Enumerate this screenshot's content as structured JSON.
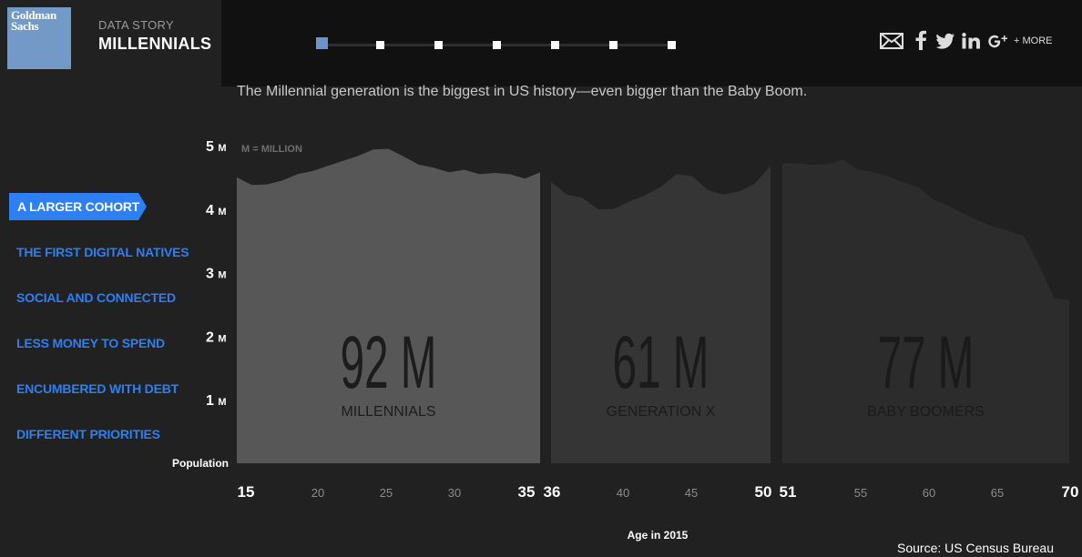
{
  "brand": {
    "logo_text": "Goldman Sachs",
    "logo_color": "#7399c6"
  },
  "header": {
    "kicker": "DATA STORY",
    "title": "MILLENNIALS"
  },
  "progress": {
    "steps": 7,
    "current": 1,
    "active_color": "#6d94c6"
  },
  "share": {
    "icons": [
      "mail-icon",
      "facebook-icon",
      "twitter-icon",
      "linkedin-icon",
      "google-plus-icon"
    ],
    "more_label": "+ MORE"
  },
  "intro_text": "The Millennial generation is the biggest in US history—even bigger than the Baby Boom.",
  "nav": {
    "items": [
      {
        "label": "A LARGER COHORT"
      },
      {
        "label": "THE FIRST DIGITAL NATIVES"
      },
      {
        "label": "SOCIAL AND CONNECTED"
      },
      {
        "label": "LESS MONEY TO SPEND"
      },
      {
        "label": "ENCUMBERED WITH DEBT"
      },
      {
        "label": "DIFFERENT PRIORITIES"
      }
    ],
    "active_index": 0,
    "accent": "#2d7ff2"
  },
  "chart_data": {
    "type": "area",
    "ylabel": "Population",
    "xlabel": "Age in 2015",
    "unit_note": "M = MILLION",
    "ylim": [
      0,
      5
    ],
    "y_ticks": [
      {
        "value": 1,
        "label": "1"
      },
      {
        "value": 2,
        "label": "2"
      },
      {
        "value": 3,
        "label": "3"
      },
      {
        "value": 4,
        "label": "4"
      },
      {
        "value": 5,
        "label": "5"
      }
    ],
    "y_tick_suffix": "M",
    "source": "Source: US Census Bureau",
    "series": [
      {
        "name": "MILLENNIALS",
        "total_label": "92 M",
        "age_range": [
          15,
          35
        ],
        "x": [
          15,
          16,
          17,
          18,
          19,
          20,
          21,
          22,
          23,
          24,
          25,
          26,
          27,
          28,
          29,
          30,
          31,
          32,
          33,
          34,
          35
        ],
        "values": [
          4.5,
          4.38,
          4.39,
          4.45,
          4.55,
          4.6,
          4.68,
          4.76,
          4.84,
          4.94,
          4.95,
          4.83,
          4.7,
          4.65,
          4.58,
          4.62,
          4.55,
          4.57,
          4.55,
          4.48,
          4.58
        ],
        "fill": "#575757",
        "label_color": "#1c1c1c",
        "tick_labels": [
          "15",
          "20",
          "25",
          "30",
          "35"
        ]
      },
      {
        "name": "GENERATION X",
        "total_label": "61 M",
        "age_range": [
          36,
          50
        ],
        "x": [
          36,
          37,
          38,
          39,
          40,
          41,
          42,
          43,
          44,
          45,
          46,
          47,
          48,
          49,
          50
        ],
        "values": [
          4.43,
          4.23,
          4.18,
          4.0,
          4.0,
          4.12,
          4.22,
          4.35,
          4.55,
          4.52,
          4.3,
          4.23,
          4.28,
          4.4,
          4.68
        ],
        "fill": "#353535",
        "label_color": "#1a1a1a",
        "tick_labels": [
          "36",
          "40",
          "45",
          "50"
        ]
      },
      {
        "name": "BABY BOOMERS",
        "total_label": "77 M",
        "age_range": [
          51,
          70
        ],
        "x": [
          51,
          52,
          53,
          54,
          55,
          56,
          57,
          58,
          59,
          60,
          61,
          62,
          63,
          64,
          65,
          66,
          67,
          68,
          69,
          70
        ],
        "values": [
          4.72,
          4.72,
          4.7,
          4.71,
          4.78,
          4.62,
          4.58,
          4.52,
          4.42,
          4.35,
          4.15,
          4.05,
          3.93,
          3.82,
          3.72,
          3.66,
          3.57,
          3.12,
          2.6,
          2.57
        ],
        "fill": "#2c2c2c",
        "label_color": "#1a1a1a",
        "tick_labels": [
          "51",
          "55",
          "60",
          "65",
          "70"
        ]
      }
    ],
    "grid": false
  }
}
